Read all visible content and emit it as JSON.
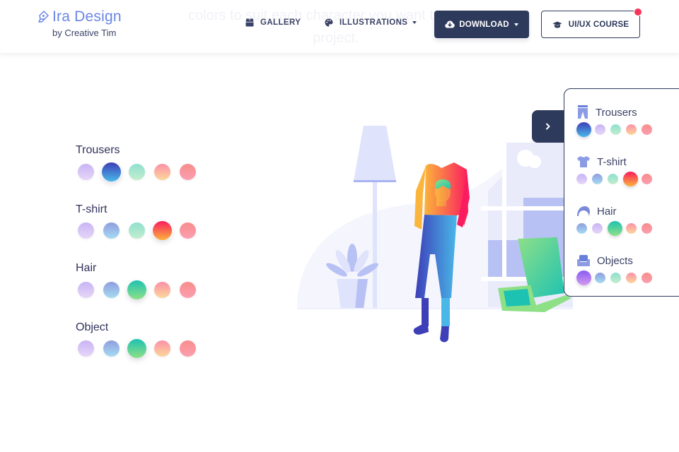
{
  "hero": {
    "faded_line1": "colors to suit each character you want to",
    "faded_line2": "project."
  },
  "navbar": {
    "brand_title": "Ira Design",
    "brand_subtitle": "by Creative Tim",
    "links": [
      {
        "label": "GALLERY",
        "icon": "box-icon"
      },
      {
        "label": "ILLUSTRATIONS",
        "icon": "palette-icon",
        "dropdown": true
      }
    ],
    "download_button": {
      "label": "DOWNLOAD",
      "icon": "cloud-download-icon",
      "dropdown": true
    },
    "course_button": {
      "label": "UI/UX COURSE",
      "icon": "graduation-cap-icon",
      "notification": true
    }
  },
  "options": {
    "groups": [
      {
        "label": "Trousers",
        "selected_index": 1
      },
      {
        "label": "T-shirt",
        "selected_index": 3
      },
      {
        "label": "Hair",
        "selected_index": 2
      },
      {
        "label": "Object",
        "selected_index": 2
      }
    ],
    "swatch_rows": [
      [
        [
          "#c8b4f6",
          "#e6d6f7"
        ],
        [
          "#3d3fb8",
          "#49b8e8"
        ],
        [
          "#8fe0d0",
          "#c3edcd"
        ],
        [
          "#fb90a8",
          "#fcd79a"
        ],
        [
          "#f88d8c",
          "#fb9fb0"
        ]
      ],
      [
        [
          "#c8b4f6",
          "#e6d6f7"
        ],
        [
          "#8f9ede",
          "#a6dbf3"
        ],
        [
          "#8fe0d0",
          "#c3edcd"
        ],
        [
          "#fa1c5f",
          "#fbb43c"
        ],
        [
          "#f88d8c",
          "#fb9fb0"
        ]
      ],
      [
        [
          "#c8b4f6",
          "#e6d6f7"
        ],
        [
          "#8f9ede",
          "#a6dbf3"
        ],
        [
          "#1ec2b2",
          "#8ee087"
        ],
        [
          "#fb90a8",
          "#fcd79a"
        ],
        [
          "#f88d8c",
          "#fb9fb0"
        ]
      ],
      [
        [
          "#c8b4f6",
          "#e6d6f7"
        ],
        [
          "#8f9ede",
          "#a6dbf3"
        ],
        [
          "#1ec2b2",
          "#8ee087"
        ],
        [
          "#fb90a8",
          "#fcd79a"
        ],
        [
          "#f88d8c",
          "#fb9fb0"
        ]
      ]
    ]
  },
  "panel": {
    "toggle_icon": "chevron-right-icon",
    "groups": [
      {
        "label": "Trousers",
        "icon": "trousers-icon",
        "selected_index": 0
      },
      {
        "label": "T-shirt",
        "icon": "tshirt-icon",
        "selected_index": 3
      },
      {
        "label": "Hair",
        "icon": "hair-icon",
        "selected_index": 2
      },
      {
        "label": "Objects",
        "icon": "armchair-icon",
        "selected_index": 0
      }
    ],
    "swatch_rows": [
      [
        [
          "#3d3fb8",
          "#49b8e8"
        ],
        [
          "#c8b4f6",
          "#e6d6f7"
        ],
        [
          "#8fe0d0",
          "#c3edcd"
        ],
        [
          "#fb90a8",
          "#fcd79a"
        ],
        [
          "#f88d8c",
          "#fb9fb0"
        ]
      ],
      [
        [
          "#c8b4f6",
          "#e6d6f7"
        ],
        [
          "#8f9ede",
          "#a6dbf3"
        ],
        [
          "#8fe0d0",
          "#c3edcd"
        ],
        [
          "#fa1c5f",
          "#fbb43c"
        ],
        [
          "#f88d8c",
          "#fb9fb0"
        ]
      ],
      [
        [
          "#8f9ede",
          "#a6dbf3"
        ],
        [
          "#c8b4f6",
          "#e6d6f7"
        ],
        [
          "#1ec2b2",
          "#8ee087"
        ],
        [
          "#fb90a8",
          "#fcd79a"
        ],
        [
          "#f88d8c",
          "#fb9fb0"
        ]
      ],
      [
        [
          "#8a5cf0",
          "#d49af0"
        ],
        [
          "#8f9ede",
          "#a6dbf3"
        ],
        [
          "#8fe0d0",
          "#c3edcd"
        ],
        [
          "#fb90a8",
          "#fcd79a"
        ],
        [
          "#f88d8c",
          "#fb9fb0"
        ]
      ]
    ]
  },
  "colors": {
    "brand": "#6a86e4",
    "primary_dark": "#2e3a5c",
    "notification": "#f5365c"
  }
}
